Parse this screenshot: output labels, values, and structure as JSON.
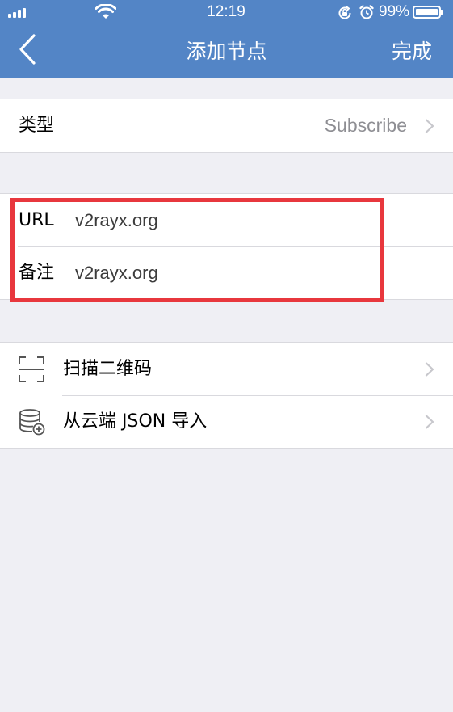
{
  "status_bar": {
    "time": "12:19",
    "battery_percent": "99%",
    "battery_level": 0.99,
    "icons": [
      "signal-icon",
      "wifi-icon",
      "rotation-lock-icon",
      "alarm-icon",
      "battery-icon"
    ]
  },
  "nav": {
    "title": "添加节点",
    "done_label": "完成",
    "back_icon": "chevron-left-icon"
  },
  "type_row": {
    "label": "类型",
    "value": "Subscribe"
  },
  "fields": {
    "url_label": "URL",
    "url_value": "v2rayx.org",
    "remark_label": "备注",
    "remark_value": "v2rayx.org"
  },
  "actions": [
    {
      "label": "扫描二维码",
      "icon": "qr-scan-icon"
    },
    {
      "label": "从云端 JSON 导入",
      "icon": "cloud-database-import-icon"
    }
  ],
  "colors": {
    "nav_background": "#5385C6",
    "page_background": "#EFEFF4",
    "highlight": "#E8373D",
    "secondary_text": "#8E8E93"
  }
}
